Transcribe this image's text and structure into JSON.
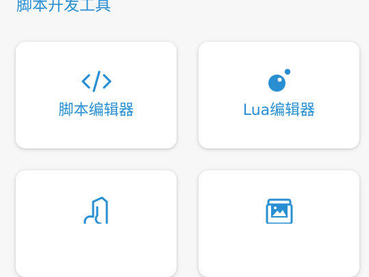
{
  "section": {
    "title": "脚本开发工具"
  },
  "cards": [
    {
      "label": "脚本编辑器",
      "icon": "code-icon"
    },
    {
      "label": "Lua编辑器",
      "icon": "lua-icon"
    },
    {
      "label": "",
      "icon": "music-file-icon"
    },
    {
      "label": "",
      "icon": "image-icon"
    }
  ],
  "colors": {
    "accent": "#2a8fd2",
    "background": "#f7f7f7",
    "card": "#ffffff"
  }
}
